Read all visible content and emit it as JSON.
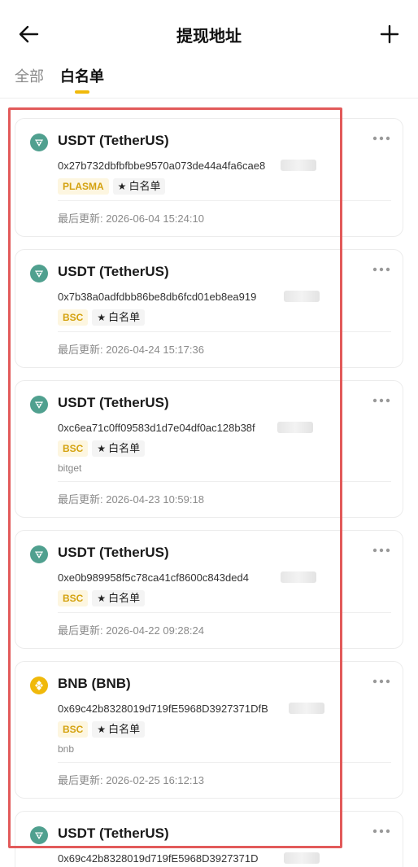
{
  "header": {
    "title": "提现地址",
    "back_icon": "arrow-left-icon",
    "add_icon": "plus-icon"
  },
  "tabs": [
    {
      "label": "全部",
      "active": false
    },
    {
      "label": "白名单",
      "active": true
    }
  ],
  "colors": {
    "accent": "#f0b90b",
    "tether": "#50a08f",
    "bnb": "#f0b90b",
    "highlight": "#e25a5a",
    "tag_text": "#d4a20f",
    "tag_bg": "#fdf6e0"
  },
  "addresses": [
    {
      "coin": "USDT (TetherUS)",
      "icon": "tether-icon",
      "address": "0x27b732dbfbfbbe9570a073de44a4fa6cae8",
      "network": "PLASMA",
      "whitelist_label": "白名单",
      "note": "",
      "updated": "最后更新: 2026-06-04 15:24:10"
    },
    {
      "coin": "USDT (TetherUS)",
      "icon": "tether-icon",
      "address": "0x7b38a0adfdbb86be8db6fcd01eb8ea919",
      "network": "BSC",
      "whitelist_label": "白名单",
      "note": "",
      "updated": "最后更新: 2026-04-24 15:17:36"
    },
    {
      "coin": "USDT (TetherUS)",
      "icon": "tether-icon",
      "address": "0xc6ea71c0ff09583d1d7e04df0ac128b38f",
      "network": "BSC",
      "whitelist_label": "白名单",
      "note": "bitget",
      "updated": "最后更新: 2026-04-23 10:59:18"
    },
    {
      "coin": "USDT (TetherUS)",
      "icon": "tether-icon",
      "address": "0xe0b989958f5c78ca41cf8600c843ded4",
      "network": "BSC",
      "whitelist_label": "白名单",
      "note": "",
      "updated": "最后更新: 2026-04-22 09:28:24"
    },
    {
      "coin": "BNB (BNB)",
      "icon": "bnb-icon",
      "address": "0x69c42b8328019d719fE5968D3927371DfB",
      "network": "BSC",
      "whitelist_label": "白名单",
      "note": "bnb",
      "updated": "最后更新: 2026-02-25 16:12:13"
    },
    {
      "coin": "USDT (TetherUS)",
      "icon": "tether-icon",
      "address": "0x69c42b8328019d719fE5968D3927371D",
      "network": "",
      "whitelist_label": "",
      "note": "",
      "updated": ""
    }
  ]
}
